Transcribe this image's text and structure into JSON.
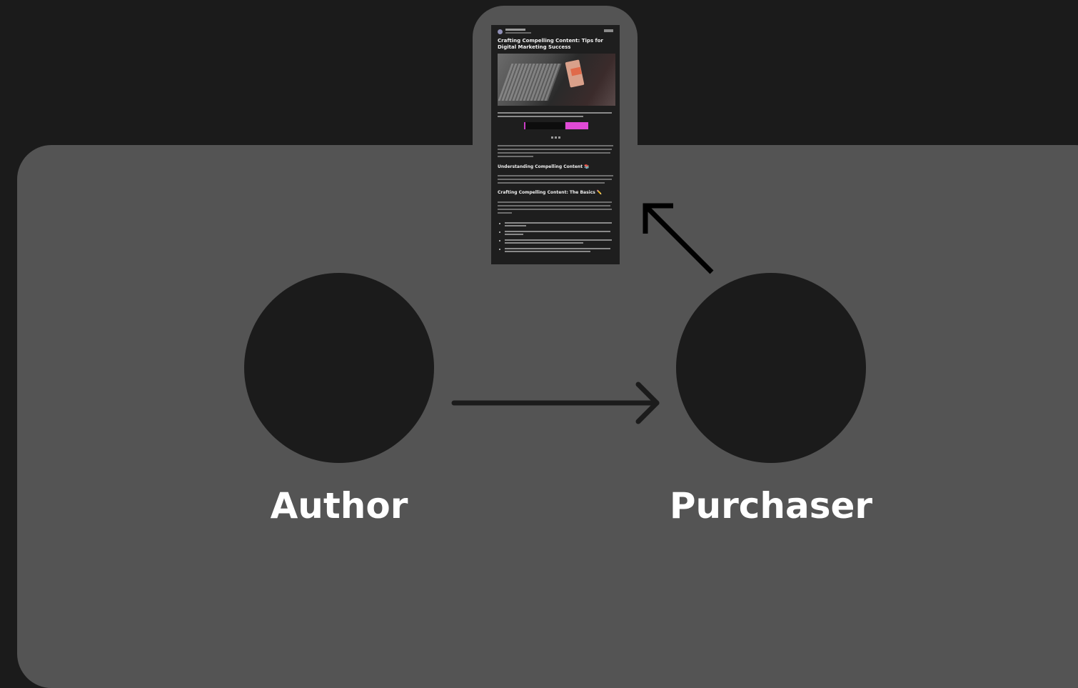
{
  "diagram": {
    "nodes": [
      {
        "id": "author",
        "label": "Author"
      },
      {
        "id": "purchaser",
        "label": "Purchaser"
      }
    ],
    "edges": [
      {
        "from": "author",
        "to": "purchaser"
      },
      {
        "from": "purchaser",
        "to": "article"
      }
    ]
  },
  "article": {
    "title": "Crafting Compelling Content: Tips for Digital Marketing Success",
    "heading_1": "Understanding Compelling Content 📚",
    "heading_2": "Crafting Compelling Content: The Basics ✏️"
  },
  "colors": {
    "background": "#1b1b1b",
    "panel": "#545454",
    "node": "#1b1b1b",
    "arrow": "#1b1b1b",
    "label": "#ffffff",
    "subscribe_button": "#e04ad6"
  }
}
